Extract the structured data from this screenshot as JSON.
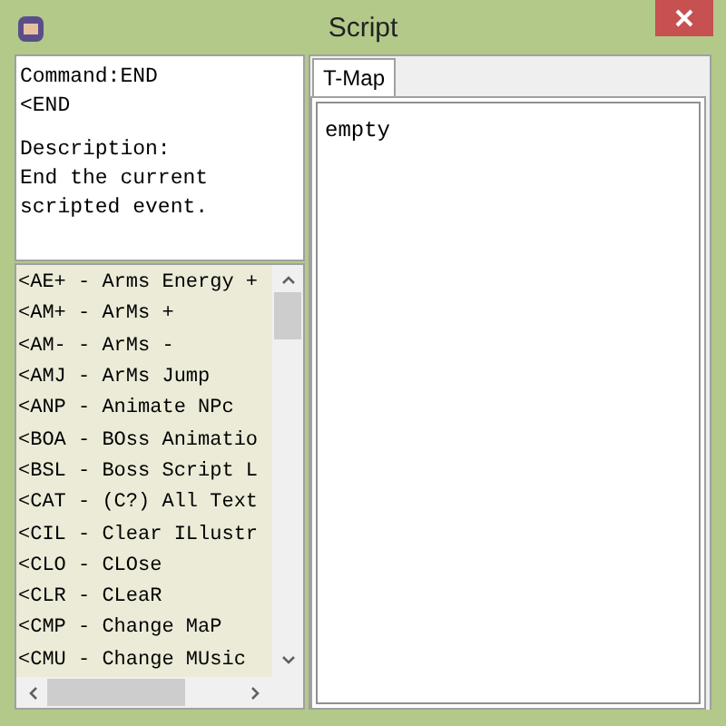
{
  "window": {
    "title": "Script"
  },
  "command_info": {
    "command": "Command:END",
    "code": "<END",
    "description_label": "Description:",
    "description": "End the current scripted event."
  },
  "commands": [
    "<AE+ - Arms Energy +",
    "<AM+ - ArMs +",
    "<AM- - ArMs -",
    "<AMJ - ArMs Jump",
    "<ANP - Animate NPc",
    "<BOA - BOss Animatio",
    "<BSL - Boss Script L",
    "<CAT - (C?) All Text",
    "<CIL - Clear ILlustr",
    "<CLO - CLOse",
    "<CLR - CLeaR",
    "<CMP - Change MaP",
    "<CMU - Change MUsic"
  ],
  "tabs": [
    {
      "label": "T-Map",
      "selected": true
    }
  ],
  "editor": {
    "value": "empty"
  }
}
